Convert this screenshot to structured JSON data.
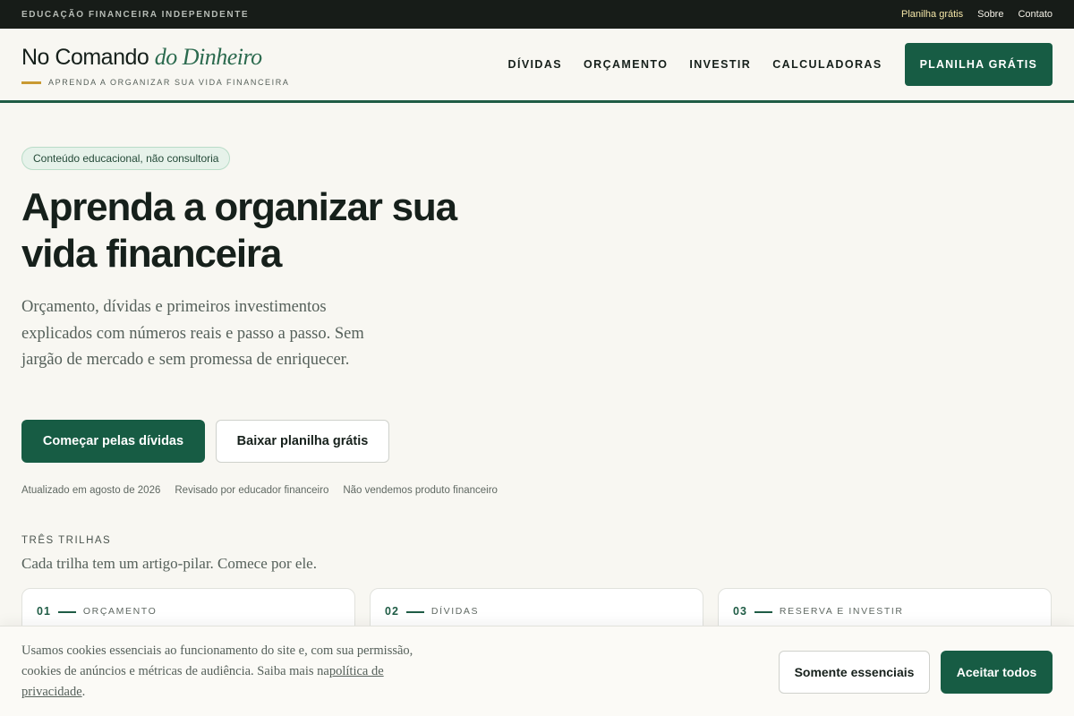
{
  "topbar": {
    "tagline": "EDUCAÇÃO FINANCEIRA INDEPENDENTE",
    "links": [
      "Planilha grátis",
      "Sobre",
      "Contato"
    ]
  },
  "header": {
    "logo_main": "No Comando",
    "logo_italic": "do Dinheiro",
    "logo_subtitle": "APRENDA A ORGANIZAR SUA VIDA FINANCEIRA",
    "nav": [
      "DÍVIDAS",
      "ORÇAMENTO",
      "INVESTIR",
      "CALCULADORAS"
    ],
    "cta": "PLANILHA GRÁTIS"
  },
  "hero": {
    "chip": "Conteúdo educacional, não consultoria",
    "title": "Aprenda a organizar sua vida financeira",
    "lead": "Orçamento, dívidas e primeiros investimentos explicados com números reais e passo a passo. Sem jargão de mercado e sem promessa de enriquecer.",
    "primary_button": "Começar pelas dívidas",
    "secondary_button": "Baixar planilha grátis",
    "meta": [
      "Atualizado em agosto de 2026",
      "Revisado por educador financeiro",
      "Não vendemos produto financeiro"
    ]
  },
  "tracks": {
    "tag": "TRÊS TRILHAS",
    "subtitle": "Cada trilha tem um artigo-pilar. Comece por ele.",
    "cards": [
      {
        "num": "01",
        "label": "ORÇAMENTO"
      },
      {
        "num": "02",
        "label": "DÍVIDAS"
      },
      {
        "num": "03",
        "label": "RESERVA E INVESTIR"
      }
    ]
  },
  "cookie": {
    "text": "Usamos cookies essenciais ao funcionamento do site e, com sua permissão, cookies de anúncios e métricas de audiência. Saiba mais na",
    "link": "política de privacidade",
    "end": ".",
    "essential_button": "Somente essenciais",
    "accept_button": "Aceitar todos"
  },
  "colors": {
    "brand_green": "#175c44",
    "accent_gold": "#c99a33",
    "topbar_bg": "#171c18",
    "page_bg": "#f8f7f2"
  }
}
